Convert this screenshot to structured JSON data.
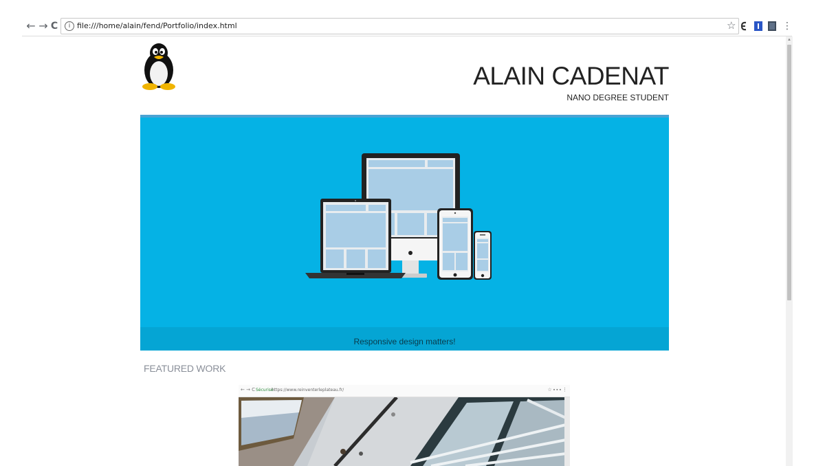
{
  "browser": {
    "back_label": "←",
    "forward_label": "→",
    "reload_label": "C",
    "info_label": "i",
    "url": "file:///home/alain/fend/Portfolio/index.html",
    "star_label": "☆",
    "menu_label": "⋮"
  },
  "header": {
    "title": "ALAIN CADENAT",
    "subtitle": "NANO DEGREE STUDENT"
  },
  "hero": {
    "caption": "Responsive design matters!"
  },
  "featured": {
    "heading": "FEATURED WORK",
    "thumb_browser": {
      "nav": "← → C",
      "secure": "Sécurisé",
      "url": "https://www.reinventerleplateau.fr/",
      "icons": "☆ ▪ ▪ ▪ ⋮"
    }
  },
  "colors": {
    "hero_blue": "#05b2e5",
    "caption_bar": "#05a5d4",
    "heading_gray": "#8a8f99"
  }
}
